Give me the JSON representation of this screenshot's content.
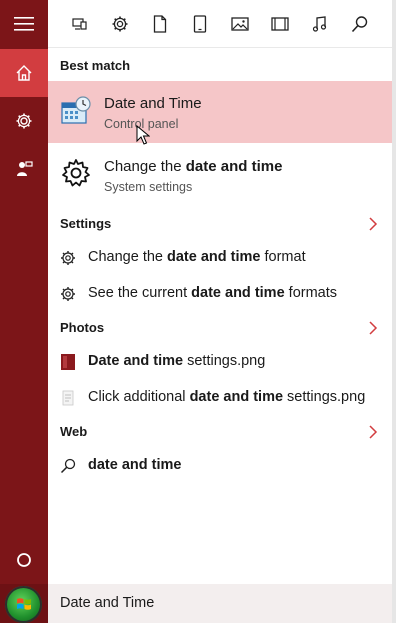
{
  "rail": {
    "items": [
      {
        "icon": "hamburger-menu-icon"
      },
      {
        "icon": "home-icon",
        "active": true
      },
      {
        "icon": "gear-icon"
      },
      {
        "icon": "feedback-person-icon"
      },
      {
        "icon": "cortana-circle-icon"
      }
    ]
  },
  "filters": [
    "apps-icon",
    "settings-icon",
    "documents-icon",
    "tablet-icon",
    "photos-icon",
    "videos-icon",
    "music-icon",
    "web-search-icon"
  ],
  "sections": {
    "best_match": "Best match",
    "settings": "Settings",
    "photos": "Photos",
    "web": "Web"
  },
  "best_match": {
    "title": "Date and Time",
    "subtitle": "Control panel"
  },
  "system_result": {
    "title_pre": "Change the ",
    "title_bold": "date and time",
    "subtitle": "System settings"
  },
  "settings_items": [
    {
      "pre": "Change the ",
      "bold": "date and time",
      "post": " format"
    },
    {
      "pre": "See the current ",
      "bold": "date and time",
      "post": " formats"
    }
  ],
  "photo_items": [
    {
      "pre": "",
      "bold": "Date and time",
      "post": " settings.png"
    },
    {
      "pre": "Click additional ",
      "bold": "date and time",
      "post": " settings.png"
    }
  ],
  "web_item": {
    "bold": "date and time"
  },
  "search": {
    "value": "Date and Time"
  },
  "colors": {
    "rail": "#7c1518",
    "rail_active": "#d23d40",
    "best_match_bg": "#f5c6c8"
  }
}
